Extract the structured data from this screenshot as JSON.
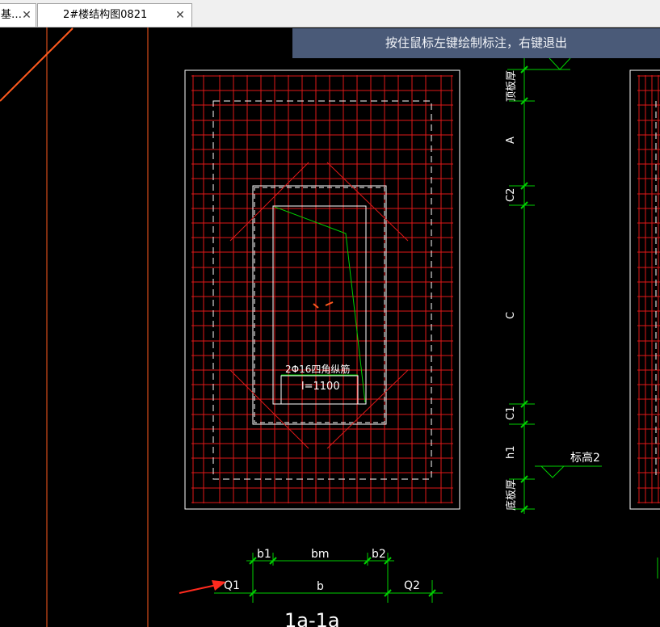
{
  "tabs": [
    {
      "label": "基…",
      "close": "✕"
    },
    {
      "label": "2#楼结构图0821",
      "close": "✕"
    }
  ],
  "tooltip": "按住鼠标左键绘制标注，右键退出",
  "drawing": {
    "rebar_label": "2Φ16四角纵筋",
    "length_label": "l=1100",
    "dimension_labels": {
      "top_plate": "顶板厚",
      "a": "A",
      "c2": "C2",
      "c": "C",
      "c1": "C1",
      "h1": "h1",
      "bottom_plate": "底板厚"
    },
    "elevation_label": "标高2",
    "bottom_dims": {
      "b1": "b1",
      "bm": "bm",
      "b2": "b2",
      "b": "b",
      "q1": "Q1",
      "q2": "Q2"
    },
    "section_title": "1a-1a"
  },
  "colors": {
    "background": "#000000",
    "rebar_grid": "#e01818",
    "outline": "#ffffff",
    "dimension": "#00d000",
    "orange": "#ff5a1e",
    "tooltip_bg": "#4a5a78"
  }
}
